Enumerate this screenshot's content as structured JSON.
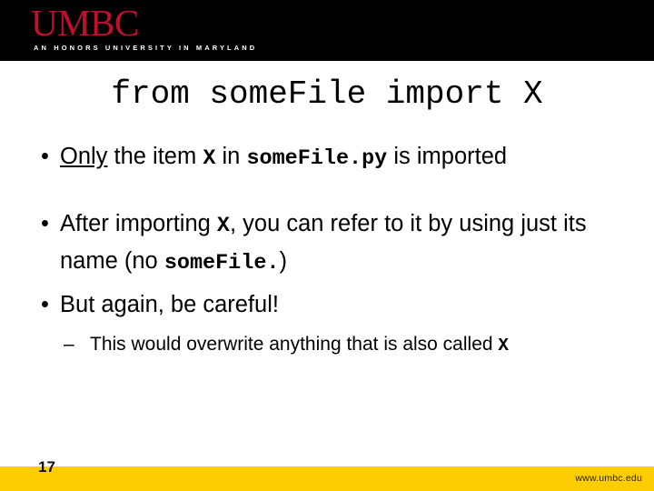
{
  "brand": {
    "logo_text": "UMBC",
    "tagline": "AN HONORS UNIVERSITY IN MARYLAND",
    "logo_color": "#c20e2e",
    "header_bg": "#000000",
    "footer_bg": "#fecd00"
  },
  "slide": {
    "title": "from someFile import X",
    "bullets": [
      {
        "parts": [
          {
            "text": "Only",
            "style": "underline"
          },
          {
            "text": " the item ",
            "style": "plain"
          },
          {
            "text": "X",
            "style": "mono"
          },
          {
            "text": " in ",
            "style": "plain"
          },
          {
            "text": "someFile.py",
            "style": "mono"
          },
          {
            "text": " is imported",
            "style": "plain"
          }
        ]
      },
      {
        "parts": [
          {
            "text": "After importing ",
            "style": "plain"
          },
          {
            "text": "X",
            "style": "mono"
          },
          {
            "text": ", you can refer to it by using just its name (no ",
            "style": "plain"
          },
          {
            "text": "someFile.",
            "style": "mono"
          },
          {
            "text": ")",
            "style": "plain"
          }
        ]
      },
      {
        "parts": [
          {
            "text": "But again, be careful!",
            "style": "plain"
          }
        ]
      }
    ],
    "sub_bullets": [
      {
        "parts": [
          {
            "text": "This would overwrite anything that is also called ",
            "style": "plain"
          },
          {
            "text": "X",
            "style": "mono"
          }
        ]
      }
    ],
    "bullet_glyph": "•",
    "sub_bullet_glyph": "–"
  },
  "footer": {
    "page_number": "17",
    "url": "www.umbc.edu"
  }
}
